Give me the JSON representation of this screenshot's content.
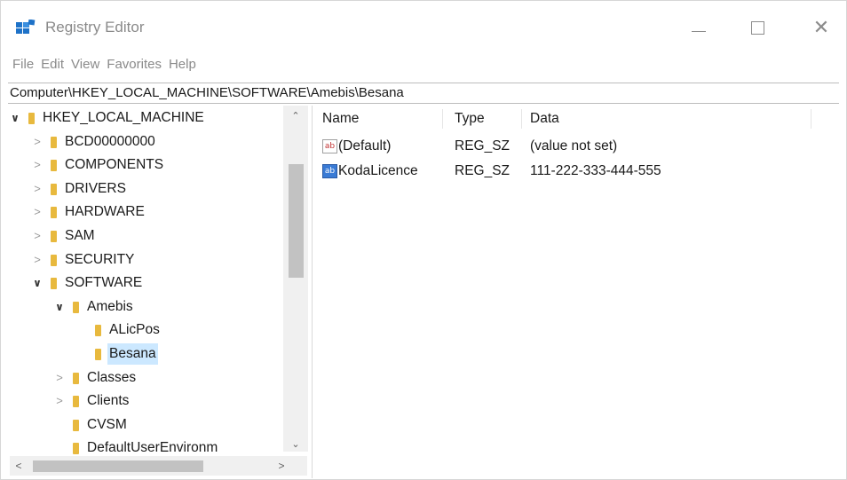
{
  "window": {
    "title": "Registry Editor",
    "controls": {
      "minimize": "—",
      "maximize": "",
      "close": "✕"
    }
  },
  "menu": [
    "File",
    "Edit",
    "View",
    "Favorites",
    "Help"
  ],
  "address": "Computer\\HKEY_LOCAL_MACHINE\\SOFTWARE\\Amebis\\Besana",
  "tree": [
    {
      "label": "HKEY_LOCAL_MACHINE",
      "expander": "expanded",
      "level": 0
    },
    {
      "label": "BCD00000000",
      "expander": "collapsed",
      "level": 1
    },
    {
      "label": "COMPONENTS",
      "expander": "collapsed",
      "level": 1
    },
    {
      "label": "DRIVERS",
      "expander": "collapsed",
      "level": 1
    },
    {
      "label": "HARDWARE",
      "expander": "collapsed",
      "level": 1
    },
    {
      "label": "SAM",
      "expander": "collapsed",
      "level": 1
    },
    {
      "label": "SECURITY",
      "expander": "collapsed",
      "level": 1
    },
    {
      "label": "SOFTWARE",
      "expander": "expanded",
      "level": 1
    },
    {
      "label": "Amebis",
      "expander": "expanded",
      "level": 2
    },
    {
      "label": "ALicPos",
      "expander": "none",
      "level": 3
    },
    {
      "label": "Besana",
      "expander": "none",
      "level": 3,
      "selected": true
    },
    {
      "label": "Classes",
      "expander": "collapsed",
      "level": 2
    },
    {
      "label": "Clients",
      "expander": "collapsed",
      "level": 2
    },
    {
      "label": "CVSM",
      "expander": "none",
      "level": 2
    },
    {
      "label": "DefaultUserEnvironm",
      "expander": "none",
      "level": 2
    }
  ],
  "columns": {
    "name": "Name",
    "type": "Type",
    "data": "Data"
  },
  "values": [
    {
      "name": "(Default)",
      "type": "REG_SZ",
      "data": "(value not set)",
      "icon": "ab",
      "selected_icon": false
    },
    {
      "name": "KodaLicence",
      "type": "REG_SZ",
      "data": "111-222-333-444-555",
      "icon": "ab",
      "selected_icon": true
    }
  ],
  "scroll": {
    "up": "⌃",
    "down": "⌄",
    "left": "<",
    "right": ">"
  },
  "colors": {
    "folder": "#e8b93e",
    "selection": "#cce8ff",
    "titlebar_text": "#8a8a8a"
  }
}
